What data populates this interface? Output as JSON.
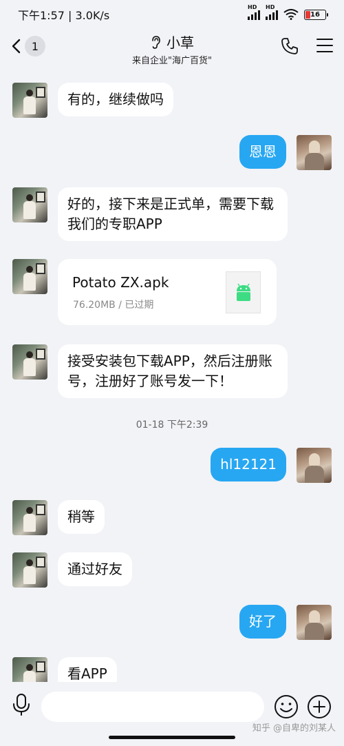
{
  "status_bar": {
    "time_speed": "下午1:57 | 3.0K/s",
    "signal1": "HD",
    "signal2": "HD",
    "battery": "16"
  },
  "header": {
    "unread_count": "1",
    "contact_name": "小草",
    "subtitle": "来自企业\"海广百货\""
  },
  "messages": [
    {
      "side": "left",
      "text": "有的，继续做吗"
    },
    {
      "side": "right",
      "text": "恩恩"
    },
    {
      "side": "left",
      "text": "好的，接下来是正式单，需要下载我们的专职APP"
    },
    {
      "side": "left",
      "type": "file",
      "file_name": "Potato ZX.apk",
      "file_meta": "76.20MB / 已过期"
    },
    {
      "side": "left",
      "text": "接受安装包下载APP，然后注册账号，注册好了账号发一下！"
    },
    {
      "type": "timestamp",
      "text": "01-18 下午2:39"
    },
    {
      "side": "right",
      "text": "hl12121"
    },
    {
      "side": "left",
      "text": "稍等"
    },
    {
      "side": "left",
      "text": "通过好友"
    },
    {
      "side": "right",
      "text": "好了"
    },
    {
      "side": "left",
      "text": "看APP"
    }
  ],
  "input": {
    "placeholder": ""
  },
  "watermark": "知乎 @自卑的刘某人",
  "colors": {
    "sent_bubble": "#27a7f2",
    "received_bubble": "#ffffff",
    "background": "#f2f3f7",
    "battery_low": "#e53935",
    "android_green": "#3ddc84"
  },
  "icons": [
    "back-chevron-icon",
    "ear-icon",
    "phone-icon",
    "menu-icon",
    "android-icon",
    "microphone-icon",
    "emoji-icon",
    "plus-icon"
  ]
}
